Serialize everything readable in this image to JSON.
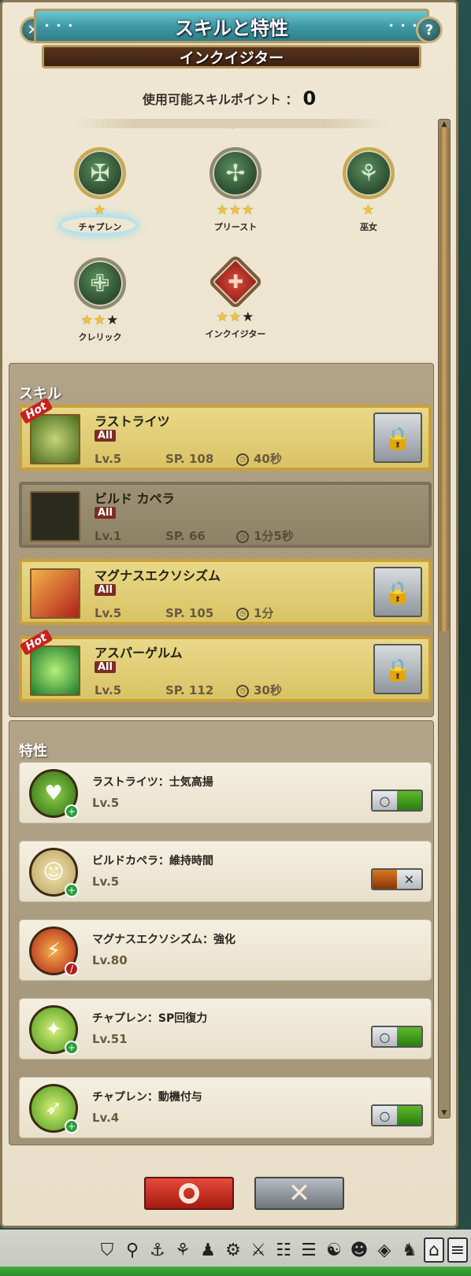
{
  "window": {
    "title": "スキルと特性",
    "subtitle": "インクイジター",
    "close_label": "✕",
    "help_label": "?"
  },
  "skill_points": {
    "label": "使用可能スキルポイント ：",
    "value": "0"
  },
  "class_tree": [
    {
      "name": "チャプレン",
      "stars_on": 1,
      "stars_total": 1,
      "selected": true
    },
    {
      "name": "プリースト",
      "stars_on": 3,
      "stars_total": 3
    },
    {
      "name": "巫女",
      "stars_on": 1,
      "stars_total": 1
    },
    {
      "name": "クレリック",
      "stars_on": 2,
      "stars_total": 3
    },
    {
      "name": "インクイジター",
      "stars_on": 2,
      "stars_total": 3
    }
  ],
  "skills_section": {
    "title": "スキル",
    "items": [
      {
        "name": "ラストライツ",
        "tag": "All",
        "lv": "Lv.5",
        "sp": "SP. 108",
        "time": "40秒",
        "hot": "Hot",
        "locked": true
      },
      {
        "name": "ビルド カペラ",
        "tag": "All",
        "lv": "Lv.1",
        "sp": "SP. 66",
        "time": "1分5秒",
        "locked": false
      },
      {
        "name": "マグナスエクソシズム",
        "tag": "All",
        "lv": "Lv.5",
        "sp": "SP. 105",
        "time": "1分",
        "locked": true
      },
      {
        "name": "アスパーゲルム",
        "tag": "All",
        "lv": "Lv.5",
        "sp": "SP. 112",
        "time": "30秒",
        "hot": "Hot",
        "locked": true
      }
    ]
  },
  "traits_section": {
    "title": "特性",
    "items": [
      {
        "name": "ラストライツ：士気高揚",
        "lv": "Lv.5",
        "toggle": "on"
      },
      {
        "name": "ビルドカペラ：維持時間",
        "lv": "Lv.5",
        "toggle": "off"
      },
      {
        "name": "マグナスエクソシズム：強化",
        "lv": "Lv.80",
        "toggle": "none"
      },
      {
        "name": "チャプレン：SP回復力",
        "lv": "Lv.51",
        "toggle": "on"
      },
      {
        "name": "チャプレン：動機付与",
        "lv": "Lv.4",
        "toggle": "on"
      }
    ]
  },
  "buttons": {
    "ok": "○",
    "cancel": "✕"
  },
  "colors": {
    "accent_gold": "#caa03a",
    "title_teal": "#3f9aa4",
    "ok_red": "#c22a1f"
  },
  "dock_icons": [
    "shield-icon",
    "map-pin-icon",
    "fish-icon",
    "magnifier-icon",
    "person-icon",
    "gift-icon",
    "crossed-swords-icon",
    "book-icon",
    "scroll-icon",
    "handshake-icon",
    "group-icon",
    "card-icon",
    "dog-icon",
    "gate-icon",
    "list-icon"
  ]
}
